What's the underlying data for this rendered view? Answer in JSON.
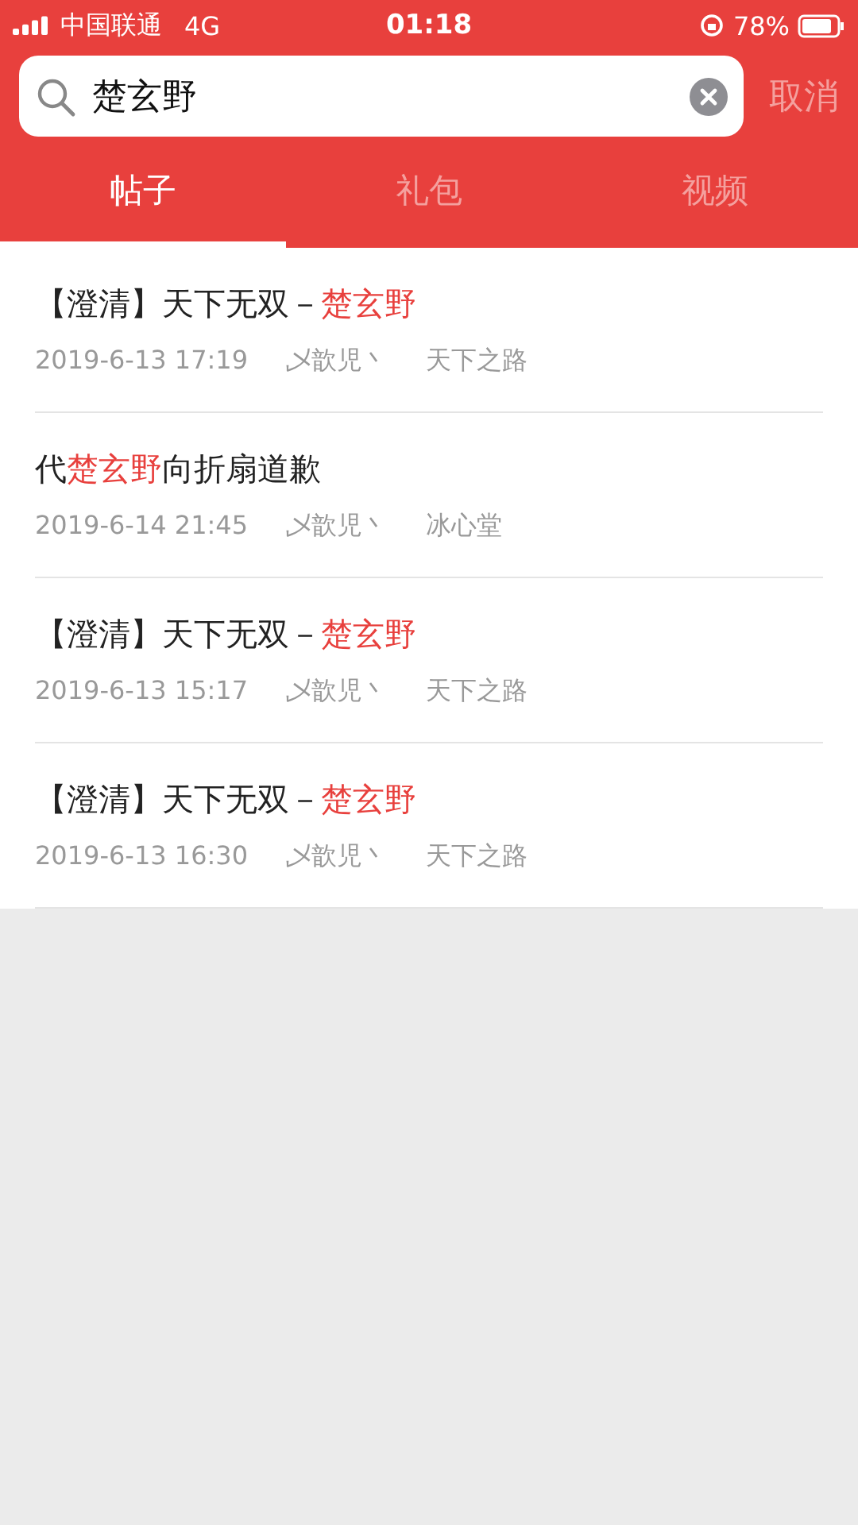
{
  "status_bar": {
    "carrier": "中国联通",
    "network": "4G",
    "time": "01:18",
    "battery": "78%"
  },
  "search": {
    "value": "楚玄野",
    "cancel": "取消"
  },
  "tabs": [
    {
      "label": "帖子",
      "selected": true
    },
    {
      "label": "礼包",
      "selected": false
    },
    {
      "label": "视频",
      "selected": false
    }
  ],
  "posts": [
    {
      "title": [
        {
          "text": "【澄清】天下无双－",
          "highlight": false
        },
        {
          "text": "楚玄野",
          "highlight": true
        }
      ],
      "date": "2019-6-13 17:19",
      "author": "乄歆児丶",
      "board": "天下之路"
    },
    {
      "title": [
        {
          "text": "代",
          "highlight": false
        },
        {
          "text": "楚玄野",
          "highlight": true
        },
        {
          "text": "向折扇道歉",
          "highlight": false
        }
      ],
      "date": "2019-6-14 21:45",
      "author": "乄歆児丶",
      "board": "冰心堂"
    },
    {
      "title": [
        {
          "text": "【澄清】天下无双－",
          "highlight": false
        },
        {
          "text": "楚玄野",
          "highlight": true
        }
      ],
      "date": "2019-6-13 15:17",
      "author": "乄歆児丶",
      "board": "天下之路"
    },
    {
      "title": [
        {
          "text": "【澄清】天下无双－",
          "highlight": false
        },
        {
          "text": "楚玄野",
          "highlight": true
        }
      ],
      "date": "2019-6-13 16:30",
      "author": "乄歆児丶",
      "board": "天下之路"
    }
  ]
}
